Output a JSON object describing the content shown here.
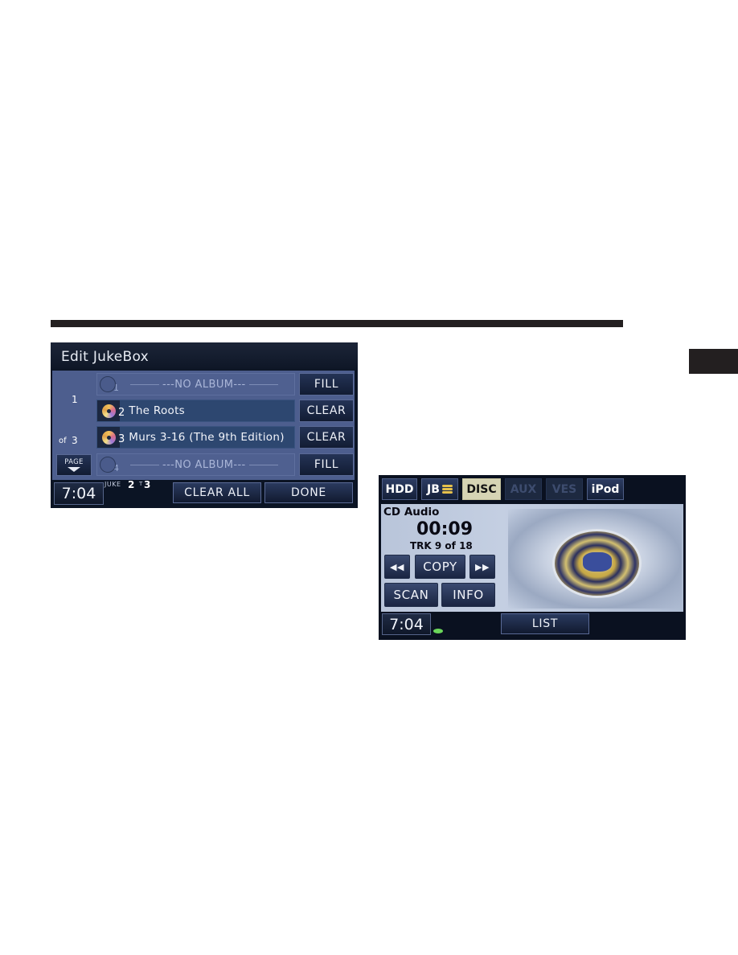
{
  "edit_jukebox": {
    "title": "Edit JukeBox",
    "page": {
      "current": "1",
      "of_label": "of",
      "total": "3",
      "page_button": "PAGE"
    },
    "rows": [
      {
        "slot": "1",
        "state": "empty",
        "label": "---NO ALBUM---",
        "action": "FILL"
      },
      {
        "slot": "2",
        "state": "filled",
        "label": "The Roots",
        "action": "CLEAR"
      },
      {
        "slot": "3",
        "state": "filled",
        "label": "Murs 3-16 (The 9th Edition)",
        "action": "CLEAR"
      },
      {
        "slot": "4",
        "state": "empty",
        "label": "---NO ALBUM---",
        "action": "FILL"
      }
    ],
    "footer": {
      "clock": "7:04",
      "juke_label": "JUKE",
      "juke_disc": "2",
      "juke_t_label": "T",
      "juke_track": "3",
      "clear_all": "CLEAR ALL",
      "done": "DONE"
    }
  },
  "cd_audio": {
    "source_tabs": [
      {
        "label": "HDD",
        "state": "normal"
      },
      {
        "label": "JB",
        "state": "normal",
        "icon": "jukebox-stack-icon"
      },
      {
        "label": "DISC",
        "state": "active"
      },
      {
        "label": "AUX",
        "state": "disabled"
      },
      {
        "label": "VES",
        "state": "disabled"
      },
      {
        "label": "iPod",
        "state": "normal"
      }
    ],
    "source_label": "CD Audio",
    "elapsed": "00:09",
    "track_info": "TRK 9 of 18",
    "buttons": {
      "rewind": "◀◀",
      "copy": "COPY",
      "forward": "▶▶",
      "scan": "SCAN",
      "info": "INFO",
      "list": "LIST"
    },
    "clock": "7:04",
    "emblem": "chrysler-emblem",
    "accent_active_tab": "#d6d4b4",
    "disc_indicator_color": "#6bd65a"
  }
}
